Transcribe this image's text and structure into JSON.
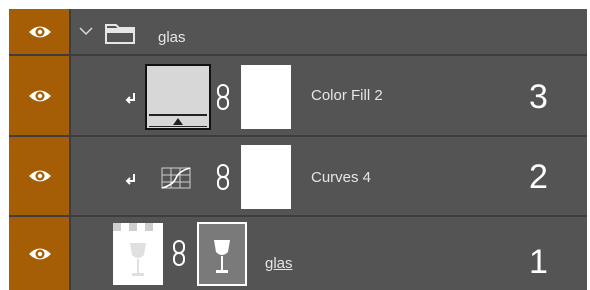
{
  "layers": [
    {
      "name": "glas",
      "type": "group",
      "expanded": true
    },
    {
      "name": "Color Fill 2",
      "type": "fill",
      "clipped": true,
      "number": "3"
    },
    {
      "name": "Curves 4",
      "type": "adjustment",
      "clipped": true,
      "number": "2"
    },
    {
      "name": "glas",
      "type": "pixel",
      "number": "1"
    }
  ],
  "icons": {
    "visibility": "eye-icon",
    "expand": "chevron-down-icon",
    "group": "folder-icon",
    "clip": "clip-arrow-icon",
    "link": "chain-link-icon",
    "curves": "curves-icon"
  },
  "colors": {
    "visibility_column": "#a55e05",
    "row_bg": "#545454",
    "text": "#e6e6e6"
  }
}
